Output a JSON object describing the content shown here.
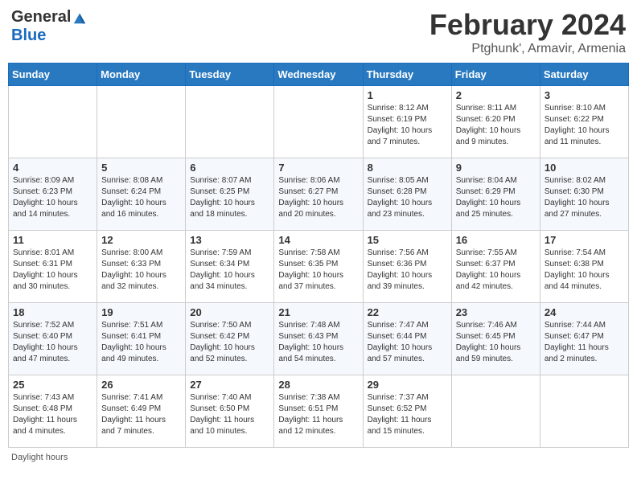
{
  "header": {
    "logo_general": "General",
    "logo_blue": "Blue",
    "title": "February 2024",
    "location": "Ptghunk', Armavir, Armenia"
  },
  "calendar": {
    "days_of_week": [
      "Sunday",
      "Monday",
      "Tuesday",
      "Wednesday",
      "Thursday",
      "Friday",
      "Saturday"
    ],
    "weeks": [
      [
        {
          "day": "",
          "info": ""
        },
        {
          "day": "",
          "info": ""
        },
        {
          "day": "",
          "info": ""
        },
        {
          "day": "",
          "info": ""
        },
        {
          "day": "1",
          "info": "Sunrise: 8:12 AM\nSunset: 6:19 PM\nDaylight: 10 hours and 7 minutes."
        },
        {
          "day": "2",
          "info": "Sunrise: 8:11 AM\nSunset: 6:20 PM\nDaylight: 10 hours and 9 minutes."
        },
        {
          "day": "3",
          "info": "Sunrise: 8:10 AM\nSunset: 6:22 PM\nDaylight: 10 hours and 11 minutes."
        }
      ],
      [
        {
          "day": "4",
          "info": "Sunrise: 8:09 AM\nSunset: 6:23 PM\nDaylight: 10 hours and 14 minutes."
        },
        {
          "day": "5",
          "info": "Sunrise: 8:08 AM\nSunset: 6:24 PM\nDaylight: 10 hours and 16 minutes."
        },
        {
          "day": "6",
          "info": "Sunrise: 8:07 AM\nSunset: 6:25 PM\nDaylight: 10 hours and 18 minutes."
        },
        {
          "day": "7",
          "info": "Sunrise: 8:06 AM\nSunset: 6:27 PM\nDaylight: 10 hours and 20 minutes."
        },
        {
          "day": "8",
          "info": "Sunrise: 8:05 AM\nSunset: 6:28 PM\nDaylight: 10 hours and 23 minutes."
        },
        {
          "day": "9",
          "info": "Sunrise: 8:04 AM\nSunset: 6:29 PM\nDaylight: 10 hours and 25 minutes."
        },
        {
          "day": "10",
          "info": "Sunrise: 8:02 AM\nSunset: 6:30 PM\nDaylight: 10 hours and 27 minutes."
        }
      ],
      [
        {
          "day": "11",
          "info": "Sunrise: 8:01 AM\nSunset: 6:31 PM\nDaylight: 10 hours and 30 minutes."
        },
        {
          "day": "12",
          "info": "Sunrise: 8:00 AM\nSunset: 6:33 PM\nDaylight: 10 hours and 32 minutes."
        },
        {
          "day": "13",
          "info": "Sunrise: 7:59 AM\nSunset: 6:34 PM\nDaylight: 10 hours and 34 minutes."
        },
        {
          "day": "14",
          "info": "Sunrise: 7:58 AM\nSunset: 6:35 PM\nDaylight: 10 hours and 37 minutes."
        },
        {
          "day": "15",
          "info": "Sunrise: 7:56 AM\nSunset: 6:36 PM\nDaylight: 10 hours and 39 minutes."
        },
        {
          "day": "16",
          "info": "Sunrise: 7:55 AM\nSunset: 6:37 PM\nDaylight: 10 hours and 42 minutes."
        },
        {
          "day": "17",
          "info": "Sunrise: 7:54 AM\nSunset: 6:38 PM\nDaylight: 10 hours and 44 minutes."
        }
      ],
      [
        {
          "day": "18",
          "info": "Sunrise: 7:52 AM\nSunset: 6:40 PM\nDaylight: 10 hours and 47 minutes."
        },
        {
          "day": "19",
          "info": "Sunrise: 7:51 AM\nSunset: 6:41 PM\nDaylight: 10 hours and 49 minutes."
        },
        {
          "day": "20",
          "info": "Sunrise: 7:50 AM\nSunset: 6:42 PM\nDaylight: 10 hours and 52 minutes."
        },
        {
          "day": "21",
          "info": "Sunrise: 7:48 AM\nSunset: 6:43 PM\nDaylight: 10 hours and 54 minutes."
        },
        {
          "day": "22",
          "info": "Sunrise: 7:47 AM\nSunset: 6:44 PM\nDaylight: 10 hours and 57 minutes."
        },
        {
          "day": "23",
          "info": "Sunrise: 7:46 AM\nSunset: 6:45 PM\nDaylight: 10 hours and 59 minutes."
        },
        {
          "day": "24",
          "info": "Sunrise: 7:44 AM\nSunset: 6:47 PM\nDaylight: 11 hours and 2 minutes."
        }
      ],
      [
        {
          "day": "25",
          "info": "Sunrise: 7:43 AM\nSunset: 6:48 PM\nDaylight: 11 hours and 4 minutes."
        },
        {
          "day": "26",
          "info": "Sunrise: 7:41 AM\nSunset: 6:49 PM\nDaylight: 11 hours and 7 minutes."
        },
        {
          "day": "27",
          "info": "Sunrise: 7:40 AM\nSunset: 6:50 PM\nDaylight: 11 hours and 10 minutes."
        },
        {
          "day": "28",
          "info": "Sunrise: 7:38 AM\nSunset: 6:51 PM\nDaylight: 11 hours and 12 minutes."
        },
        {
          "day": "29",
          "info": "Sunrise: 7:37 AM\nSunset: 6:52 PM\nDaylight: 11 hours and 15 minutes."
        },
        {
          "day": "",
          "info": ""
        },
        {
          "day": "",
          "info": ""
        }
      ]
    ]
  },
  "footer": {
    "note": "Daylight hours"
  }
}
